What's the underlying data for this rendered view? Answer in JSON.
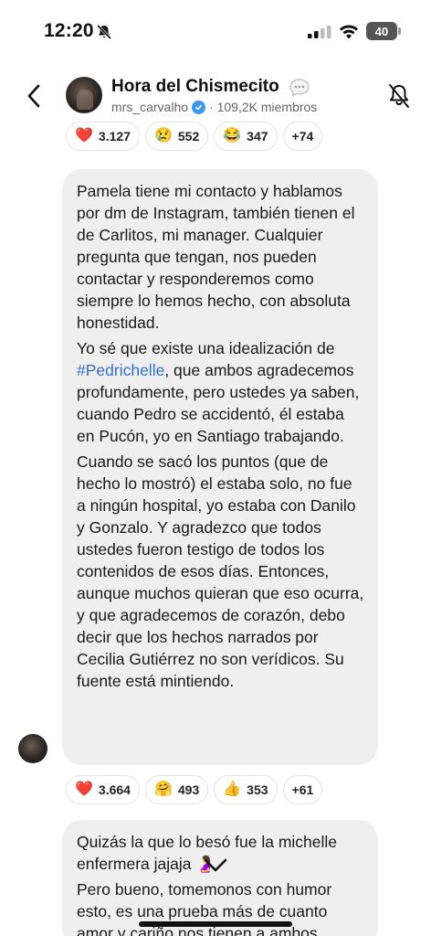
{
  "status_bar": {
    "time": "12:20",
    "battery": "40"
  },
  "header": {
    "title": "Hora del Chismecito",
    "title_icon": "speech-bubble-icon",
    "handle": "mrs_carvalho",
    "member_count": "· 109,2K miembros"
  },
  "reactions_top": [
    {
      "emoji": "❤️",
      "count": "3.127"
    },
    {
      "emoji": "😢",
      "count": "552"
    },
    {
      "emoji": "😂",
      "count": "347"
    },
    {
      "emoji": "",
      "count": "+74"
    }
  ],
  "message_main": {
    "paragraphs": [
      "Pamela tiene mi contacto y hablamos por dm de Instagram, también tienen el de Carlitos, mi manager. Cualquier pregunta que tengan, nos pueden contactar y responderemos como siempre lo hemos hecho, con absoluta honestidad.",
      "Yo sé que existe una idealización de",
      "Cuando se sacó los puntos (que de hecho lo mostró) el estaba solo, no fue a ningún hospital, yo estaba con Danilo y Gonzalo. Y agradezco que todos ustedes fueron testigo de todos los contenidos de esos días. Entonces, aunque muchos quieran que eso ocurra, y que agradecemos de corazón, debo decir que los hechos narrados por Cecilia Gutiérrez no son verídicos. Su fuente está mintiendo."
    ],
    "hashtag": "#Pedrichelle",
    "after_hashtag": ", que ambos agradecemos profundamente, pero ustedes ya saben, cuando Pedro se accidentó, él estaba en Pucón, yo en Santiago trabajando."
  },
  "reactions_bottom": [
    {
      "emoji": "❤️",
      "count": "3.664"
    },
    {
      "emoji": "🤗",
      "count": "493"
    },
    {
      "emoji": "👍",
      "count": "353"
    },
    {
      "emoji": "",
      "count": "+61"
    }
  ],
  "message_next": {
    "line1": "Quizás la que lo besó fue la michelle enfermera jajaja 🤰",
    "line2": "Pero bueno, tomemonos con humor esto, es una prueba más de cuanto amor y cariño nos tienen a ambos"
  },
  "colors": {
    "bubble": "#efefef",
    "hashtag": "#2f6fd6",
    "verified": "#3897f0"
  }
}
